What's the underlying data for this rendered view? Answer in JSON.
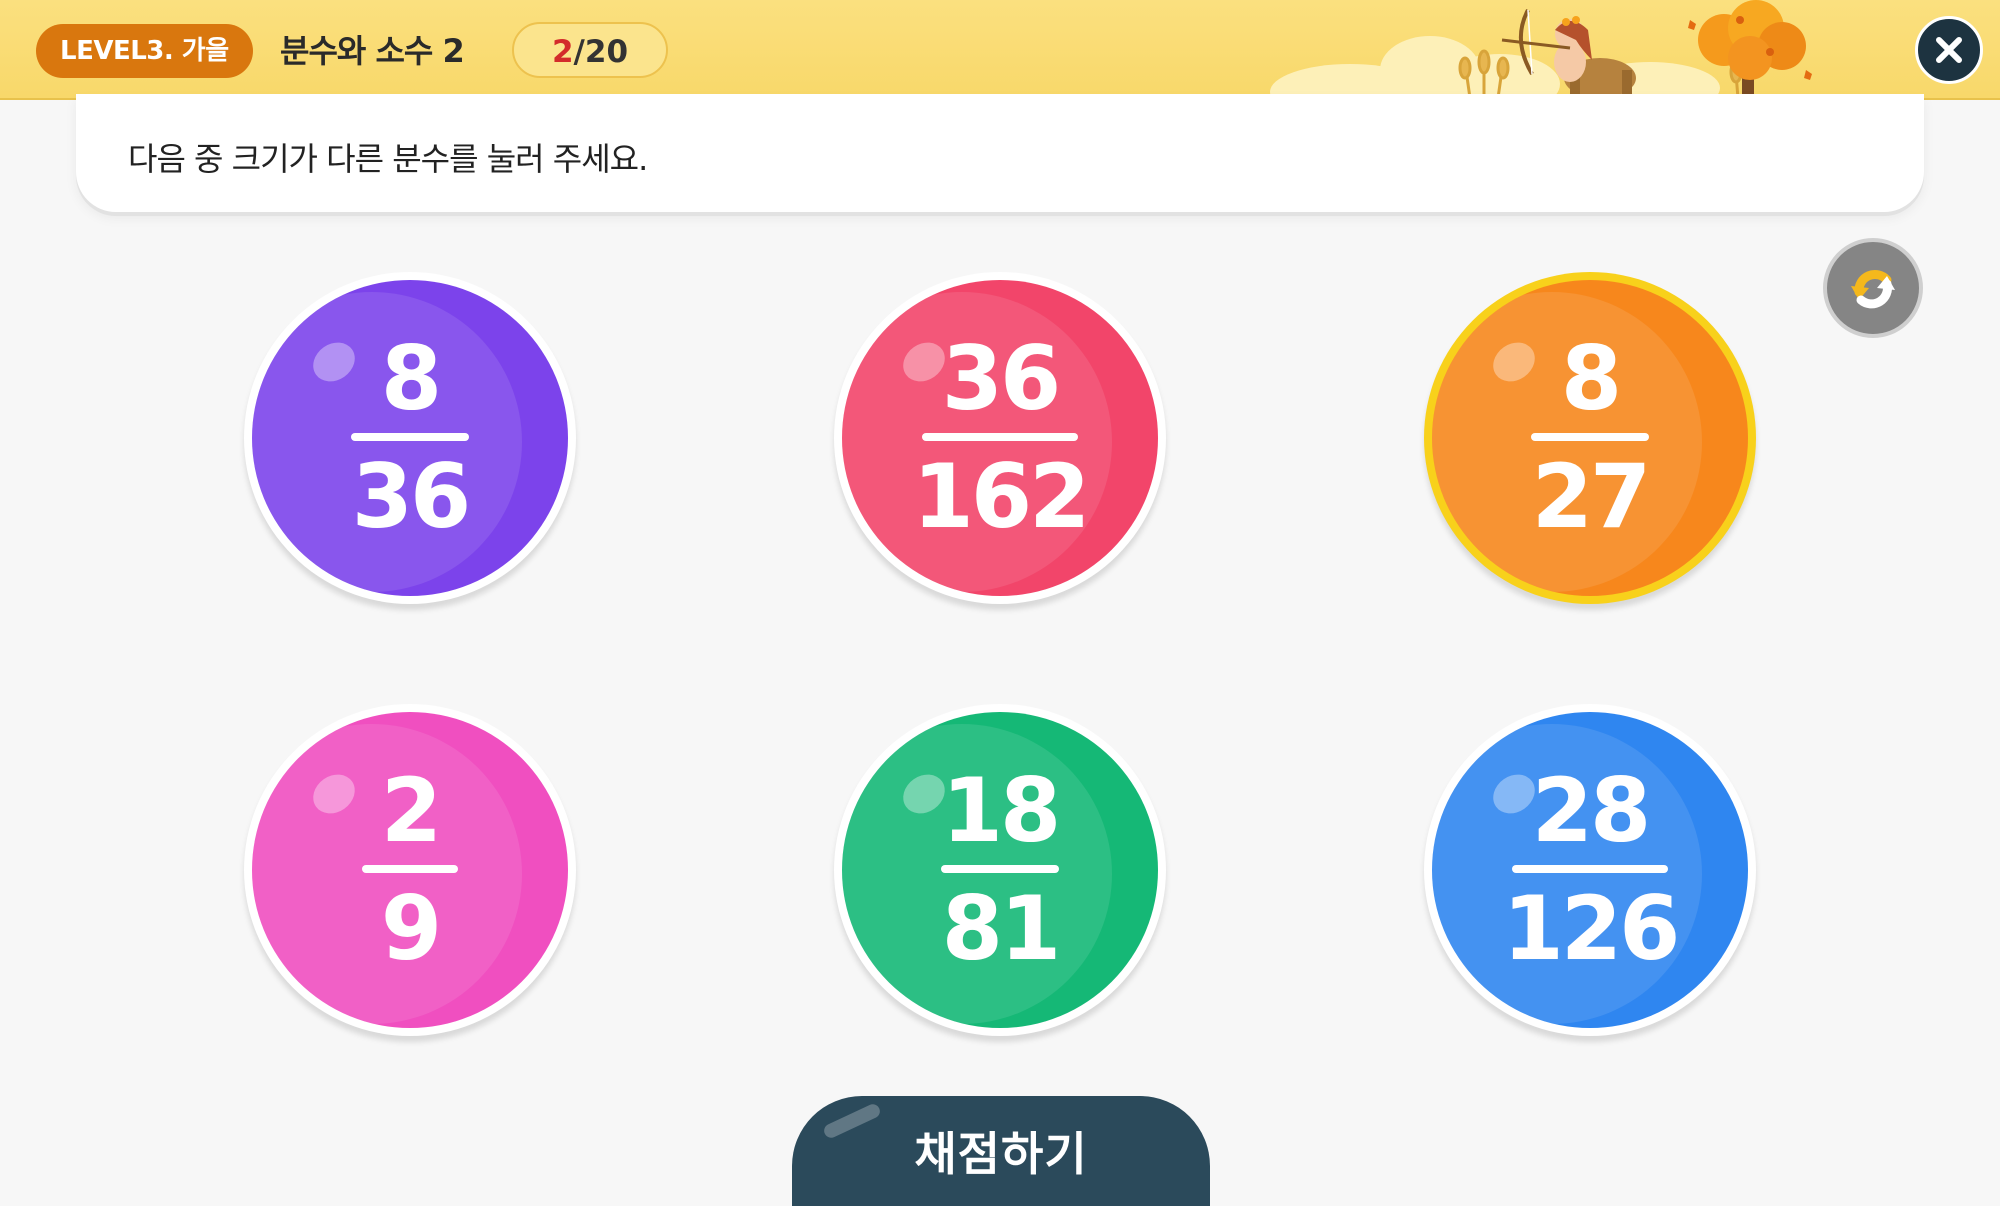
{
  "header": {
    "level_label": "LEVEL3. 가을",
    "topic": "분수와 소수 2",
    "progress_current": "2",
    "progress_total": "/20",
    "close_icon": "close-icon"
  },
  "question": {
    "text": "다음 중 크기가 다른 분수를 눌러 주세요."
  },
  "refresh_icon": "refresh-icon",
  "choices": [
    {
      "numerator": "8",
      "denominator": "36",
      "color": "#7c43eb",
      "selected": false
    },
    {
      "numerator": "36",
      "denominator": "162",
      "color": "#f2456a",
      "selected": false
    },
    {
      "numerator": "8",
      "denominator": "27",
      "color": "#f7871c",
      "selected": true
    },
    {
      "numerator": "2",
      "denominator": "9",
      "color": "#f04fc0",
      "selected": false
    },
    {
      "numerator": "18",
      "denominator": "81",
      "color": "#15b876",
      "selected": false
    },
    {
      "numerator": "28",
      "denominator": "126",
      "color": "#2f86f0",
      "selected": false
    }
  ],
  "grade_button": {
    "label": "채점하기"
  },
  "colors": {
    "header_bg": "#f8d86a",
    "level_pill": "#d9770e",
    "selected_ring": "#f8d11b",
    "grade_button_bg": "#2b4a5b"
  }
}
